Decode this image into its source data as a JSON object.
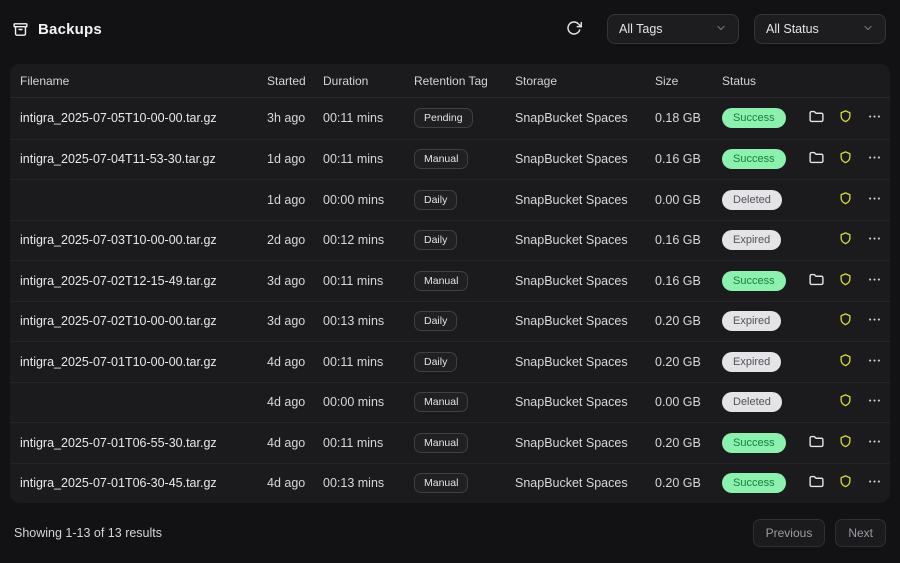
{
  "header": {
    "title": "Backups",
    "tags_filter": "All Tags",
    "status_filter": "All Status"
  },
  "icons": {
    "title_icon": "archive-box-icon",
    "refresh": "refresh-icon",
    "dropdown": "chevron-down-icon",
    "row_actions": [
      "folder-icon",
      "shield-icon",
      "ellipsis-icon"
    ]
  },
  "colors": {
    "page_bg": "#121214",
    "panel_bg": "#1b1b1e",
    "success_badge_bg": "#8cf0ae",
    "success_badge_text": "#17813f",
    "neutral_badge_bg": "#e4e4e7",
    "neutral_badge_text": "#52525b",
    "shield_icon": "#d6d93c"
  },
  "table": {
    "columns": [
      "Filename",
      "Started",
      "Duration",
      "Retention Tag",
      "Storage",
      "Size",
      "Status"
    ],
    "rows": [
      {
        "filename": "intigra_2025-07-05T10-00-00.tar.gz",
        "started": "3h ago",
        "duration": "00:11 mins",
        "tag": "Pending",
        "storage": "SnapBucket Spaces",
        "size": "0.18 GB",
        "status": "Success",
        "folder": true
      },
      {
        "filename": "intigra_2025-07-04T11-53-30.tar.gz",
        "started": "1d ago",
        "duration": "00:11 mins",
        "tag": "Manual",
        "storage": "SnapBucket Spaces",
        "size": "0.16 GB",
        "status": "Success",
        "folder": true
      },
      {
        "filename": "",
        "started": "1d ago",
        "duration": "00:00 mins",
        "tag": "Daily",
        "storage": "SnapBucket Spaces",
        "size": "0.00 GB",
        "status": "Deleted",
        "folder": false
      },
      {
        "filename": "intigra_2025-07-03T10-00-00.tar.gz",
        "started": "2d ago",
        "duration": "00:12 mins",
        "tag": "Daily",
        "storage": "SnapBucket Spaces",
        "size": "0.16 GB",
        "status": "Expired",
        "folder": false
      },
      {
        "filename": "intigra_2025-07-02T12-15-49.tar.gz",
        "started": "3d ago",
        "duration": "00:11 mins",
        "tag": "Manual",
        "storage": "SnapBucket Spaces",
        "size": "0.16 GB",
        "status": "Success",
        "folder": true
      },
      {
        "filename": "intigra_2025-07-02T10-00-00.tar.gz",
        "started": "3d ago",
        "duration": "00:13 mins",
        "tag": "Daily",
        "storage": "SnapBucket Spaces",
        "size": "0.20 GB",
        "status": "Expired",
        "folder": false
      },
      {
        "filename": "intigra_2025-07-01T10-00-00.tar.gz",
        "started": "4d ago",
        "duration": "00:11 mins",
        "tag": "Daily",
        "storage": "SnapBucket Spaces",
        "size": "0.20 GB",
        "status": "Expired",
        "folder": false
      },
      {
        "filename": "",
        "started": "4d ago",
        "duration": "00:00 mins",
        "tag": "Manual",
        "storage": "SnapBucket Spaces",
        "size": "0.00 GB",
        "status": "Deleted",
        "folder": false
      },
      {
        "filename": "intigra_2025-07-01T06-55-30.tar.gz",
        "started": "4d ago",
        "duration": "00:11 mins",
        "tag": "Manual",
        "storage": "SnapBucket Spaces",
        "size": "0.20 GB",
        "status": "Success",
        "folder": true
      },
      {
        "filename": "intigra_2025-07-01T06-30-45.tar.gz",
        "started": "4d ago",
        "duration": "00:13 mins",
        "tag": "Manual",
        "storage": "SnapBucket Spaces",
        "size": "0.20 GB",
        "status": "Success",
        "folder": true
      }
    ]
  },
  "footer": {
    "summary": "Showing 1-13 of 13 results",
    "previous_label": "Previous",
    "next_label": "Next"
  }
}
